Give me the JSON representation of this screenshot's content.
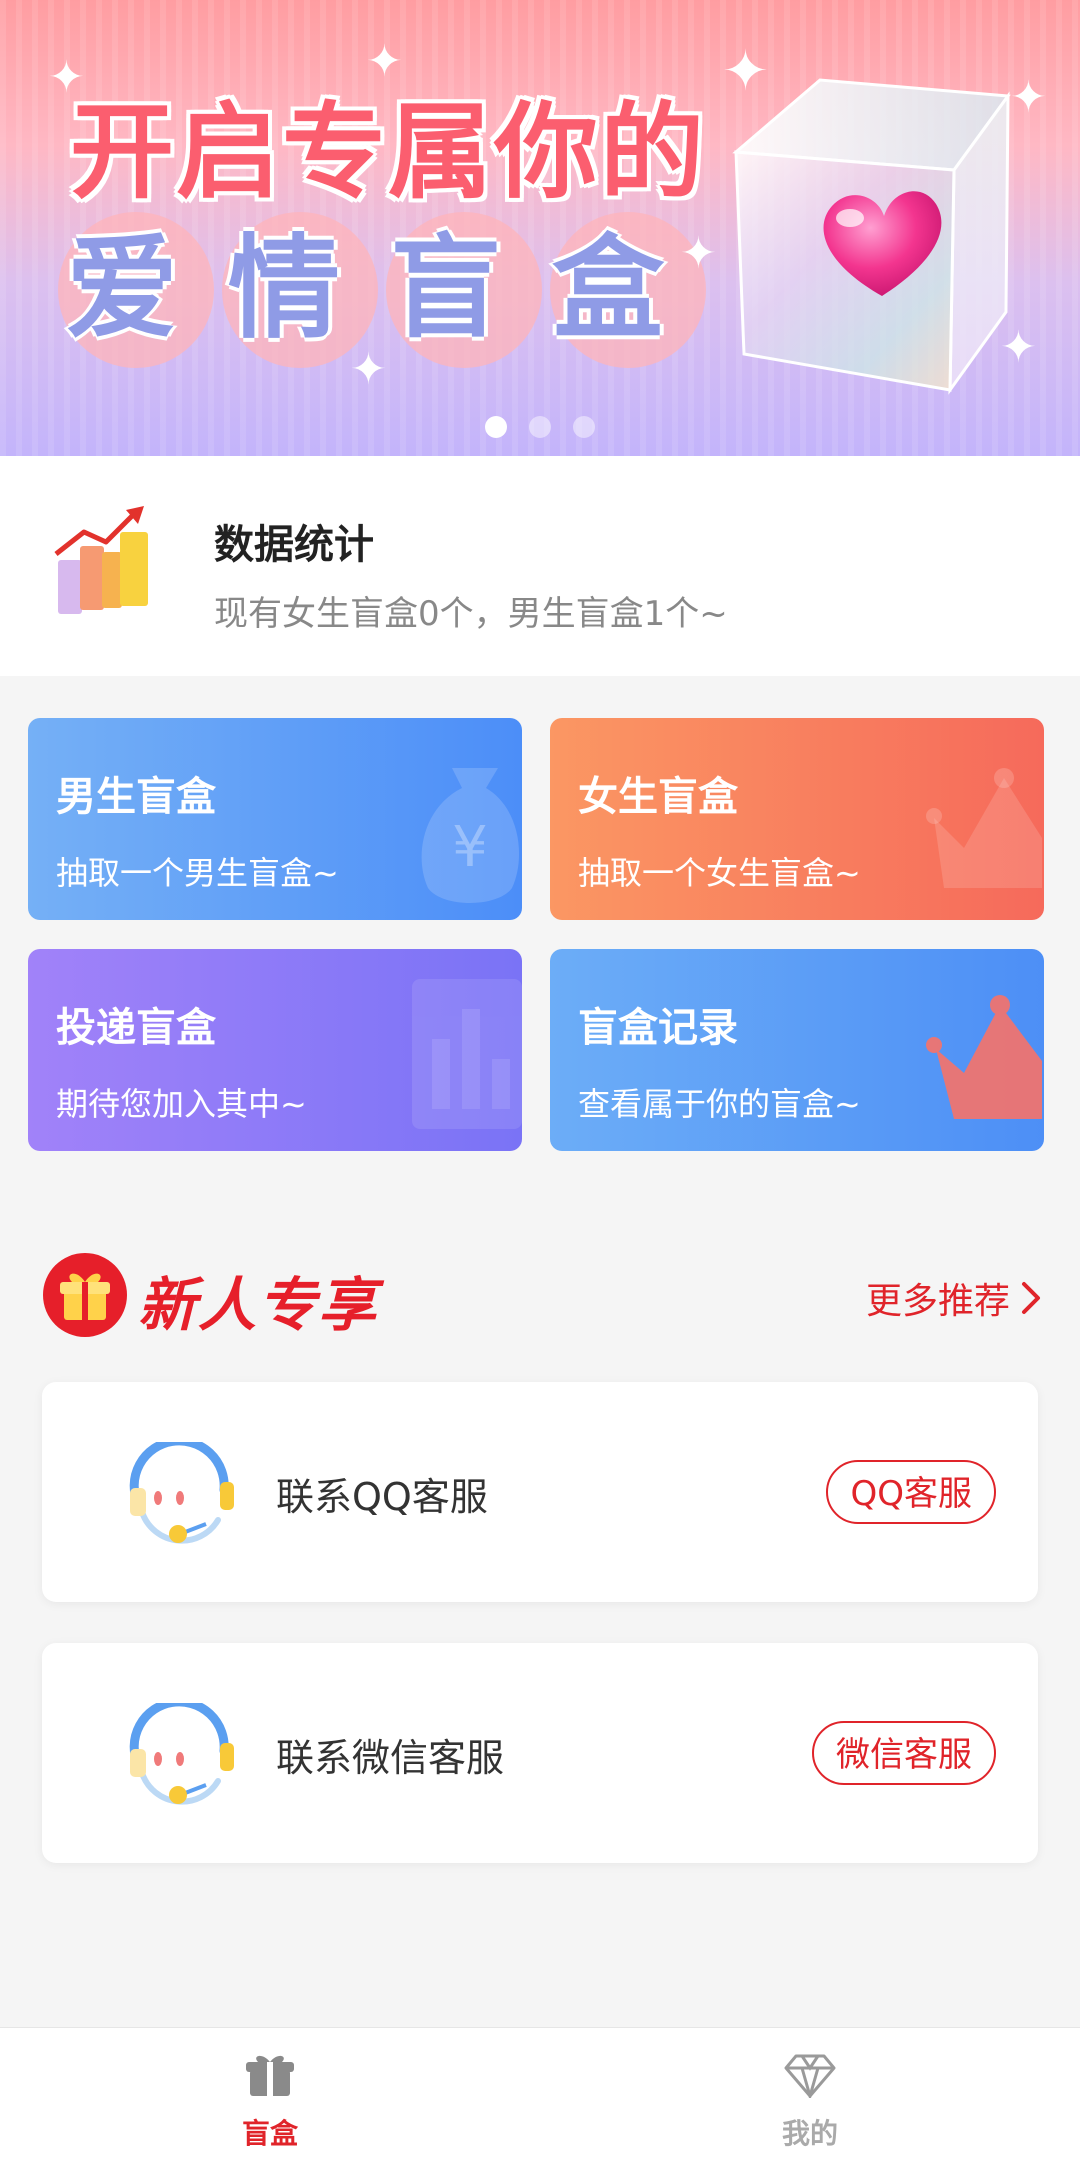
{
  "banner": {
    "line1": "开启专属你的",
    "line2": "爱情盲盒",
    "slides": 3,
    "active_slide": 1
  },
  "stats": {
    "title": "数据统计",
    "subtitle": "现有女生盲盒0个，男生盲盒1个~"
  },
  "cards": [
    {
      "title": "男生盲盒",
      "subtitle": "抽取一个男生盲盒~",
      "icon": "money-bag-icon"
    },
    {
      "title": "女生盲盒",
      "subtitle": "抽取一个女生盲盒~",
      "icon": "crown-icon"
    },
    {
      "title": "投递盲盒",
      "subtitle": "期待您加入其中~",
      "icon": "chart-icon"
    },
    {
      "title": "盲盒记录",
      "subtitle": "查看属于你的盲盒~",
      "icon": "crown-icon"
    }
  ],
  "section": {
    "title": "新人专享",
    "more": "更多推荐"
  },
  "contacts": [
    {
      "label": "联系QQ客服",
      "button": "QQ客服",
      "icon": "headset-icon"
    },
    {
      "label": "联系微信客服",
      "button": "微信客服",
      "icon": "headset-icon"
    }
  ],
  "tabbar": {
    "tabs": [
      {
        "label": "盲盒",
        "icon": "gift-icon",
        "active": true
      },
      {
        "label": "我的",
        "icon": "diamond-icon",
        "active": false
      }
    ]
  },
  "colors": {
    "accent": "#e0242a",
    "male_card": "#5b9cf7",
    "female_card": "#f7785d",
    "post_card": "#8c7bf8",
    "record_card": "#5a9bf7"
  }
}
